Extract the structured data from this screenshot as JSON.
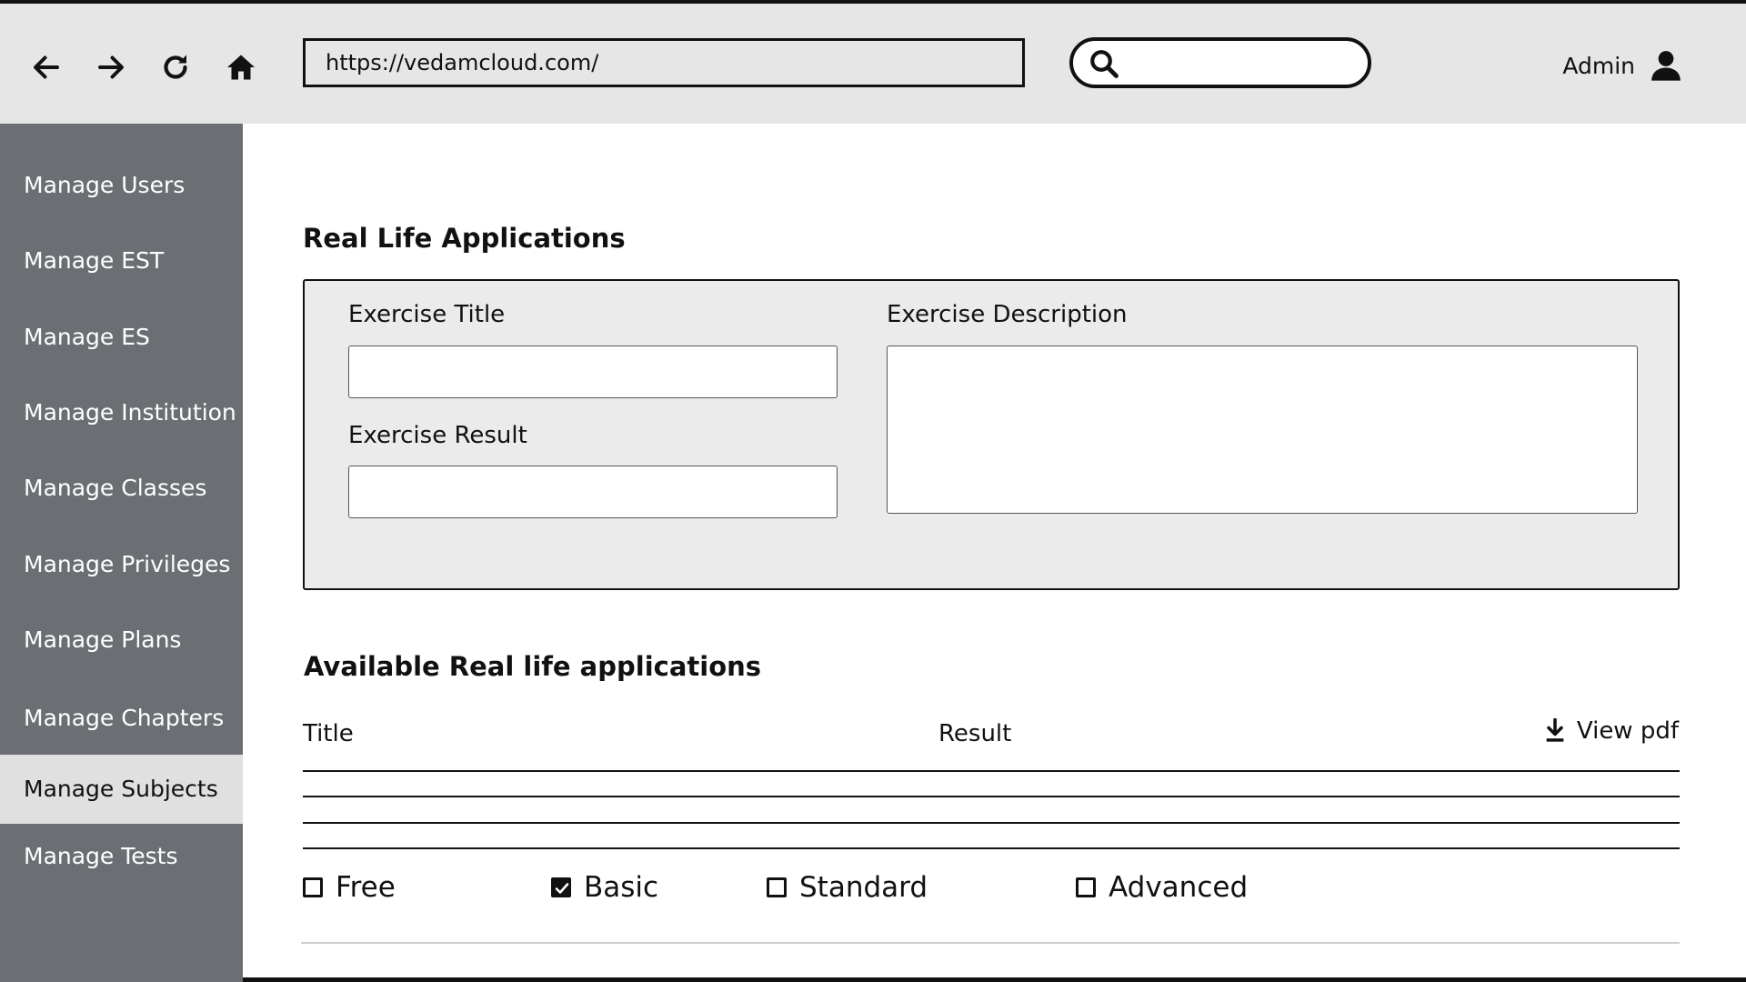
{
  "browser": {
    "url": "https://vedamcloud.com/",
    "search_placeholder": "",
    "user_label": "Admin"
  },
  "sidebar": {
    "items": [
      {
        "label": "Manage Users",
        "active": false
      },
      {
        "label": "Manage EST",
        "active": false
      },
      {
        "label": "Manage ES",
        "active": false
      },
      {
        "label": "Manage Institution",
        "active": false
      },
      {
        "label": "Manage Classes",
        "active": false
      },
      {
        "label": "Manage Privileges",
        "active": false
      },
      {
        "label": "Manage Plans",
        "active": false
      },
      {
        "label": "Manage Chapters",
        "active": false
      },
      {
        "label": "Manage Subjects",
        "active": true
      },
      {
        "label": "Manage Tests",
        "active": false
      }
    ]
  },
  "form": {
    "heading": "Real Life Applications",
    "title_label": "Exercise Title",
    "title_value": "",
    "result_label": "Exercise Result",
    "result_value": "",
    "description_label": "Exercise Description",
    "description_value": ""
  },
  "list": {
    "heading": "Available Real life applications",
    "columns": {
      "title": "Title",
      "result": "Result",
      "pdf": "View pdf"
    }
  },
  "plans": [
    {
      "label": "Free",
      "checked": false
    },
    {
      "label": "Basic",
      "checked": true
    },
    {
      "label": "Standard",
      "checked": false
    },
    {
      "label": "Advanced",
      "checked": false
    }
  ],
  "icons": {
    "back": "arrow-left-icon",
    "forward": "arrow-right-icon",
    "reload": "reload-icon",
    "home": "home-icon",
    "search": "search-icon",
    "user": "user-icon",
    "download": "download-icon"
  },
  "colors": {
    "header_bg": "#e6e6e6",
    "sidebar_bg": "#6b6e73",
    "sidebar_active_bg": "#e0e0e0",
    "form_bg": "#ebebeb"
  }
}
